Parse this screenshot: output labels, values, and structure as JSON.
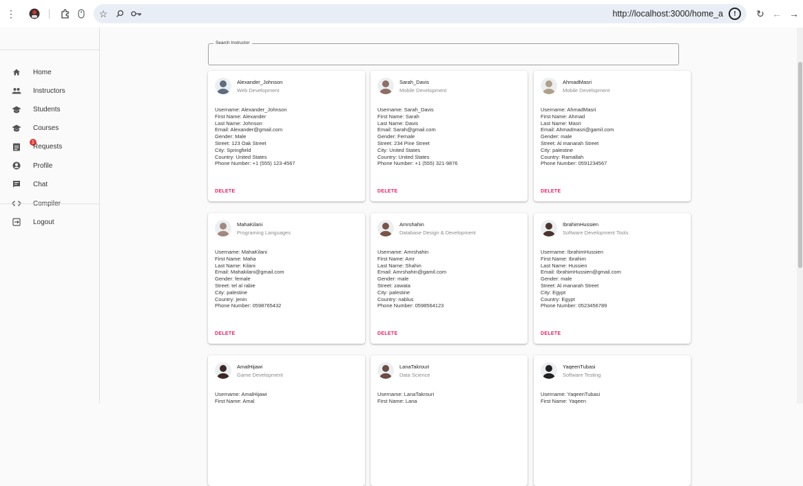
{
  "browser": {
    "url": "http://localhost:3000/home_a"
  },
  "sidebar": {
    "items": [
      {
        "label": "Home",
        "icon": "home-icon"
      },
      {
        "label": "Instructors",
        "icon": "group-icon"
      },
      {
        "label": "Students",
        "icon": "school-icon"
      },
      {
        "label": "Courses",
        "icon": "school-icon"
      },
      {
        "label": "Requests",
        "icon": "assignment-icon",
        "badge": "1"
      },
      {
        "label": "Profile",
        "icon": "account-icon"
      },
      {
        "label": "Chat",
        "icon": "chat-icon"
      },
      {
        "label": "Compiler",
        "icon": "code-icon"
      },
      {
        "label": "Logout",
        "icon": "logout-icon"
      }
    ]
  },
  "search": {
    "label": "Search Instructor",
    "value": ""
  },
  "cards": [
    {
      "name": "Alexander_Johnson",
      "specialty": "Web Development",
      "lines": [
        "Username: Alexander_Johnson",
        "First Name: Alexander",
        "Last Name: Johnson",
        "Email: Alexander@gmail.com",
        "Gender: Male",
        "Street: 123 Oak Street",
        "City: Springfield",
        "Country: United States",
        "Phone Number: +1 (555) 123-4567"
      ],
      "delete_label": "DELETE",
      "avatar_color": "#5d6d7e"
    },
    {
      "name": "Sarah_Davis",
      "specialty": "Mobile Development",
      "lines": [
        "Username: Sarah_Davis",
        "First Name: Sarah",
        "Last Name: Davis",
        "Email: Sarah@gmail.com",
        "Gender: Female",
        "Street: 234 Pine Street",
        "City: United States",
        "Country: United States",
        "Phone Number: +1 (555) 321-9876"
      ],
      "delete_label": "DELETE",
      "avatar_color": "#8d6e63"
    },
    {
      "name": "AhmadMasri",
      "specialty": "Mobile Development",
      "lines": [
        "Username: AhmadMasri",
        "First Name: Ahmad",
        "Last Name: Masri",
        "Email: Ahmadmasri@gamil.com",
        "Gender: male",
        "Street: Al manarah Street",
        "City: palestine",
        "Country: Ramallah",
        "Phone Number: 0591234567"
      ],
      "delete_label": "DELETE",
      "avatar_color": "#b0a089"
    },
    {
      "name": "MahaKilani",
      "specialty": "Programing Languages",
      "lines": [
        "Username: MahaKilani",
        "First Name: Maha",
        "Last Name: Kilani",
        "Email: Mahakilani@gmail.com",
        "Gender: female",
        "Street: tel al rabie",
        "City: palestine",
        "Country: jenin",
        "Phone Number: 0598765432"
      ],
      "delete_label": "DELETE",
      "avatar_color": "#a1887f"
    },
    {
      "name": "Amrshahin",
      "specialty": "Database Design & Development",
      "lines": [
        "Username: Amrshahin",
        "First Name: Amr",
        "Last Name: Shahin",
        "Email: Amrshahin@gamil.com",
        "Gender: male",
        "Street: zawata",
        "City: palestine",
        "Country: nablus",
        "Phone Number: 0598564123"
      ],
      "delete_label": "DELETE",
      "avatar_color": "#795548"
    },
    {
      "name": "IbrahimHussien",
      "specialty": "Software Development Tools",
      "lines": [
        "Username: IbrahimHussien",
        "First Name: Ibrahim",
        "Last Name: Hussien",
        "Email: IbrahimHussien@gmail.com",
        "Gender: male",
        "Street: Al manarah Street",
        "City: Egypt",
        "Country: Egypt",
        "Phone Number: 0523456789"
      ],
      "delete_label": "DELETE",
      "avatar_color": "#4e342e"
    },
    {
      "name": "AmalHijawi",
      "specialty": "Game Development",
      "lines": [
        "Username: AmalHijawi",
        "First Name: Amal"
      ],
      "delete_label": "",
      "avatar_color": "#3e2723"
    },
    {
      "name": "LanaTakrouri",
      "specialty": "Data Science",
      "lines": [
        "Username: LanaTakrouri",
        "First Name: Lana"
      ],
      "delete_label": "",
      "avatar_color": "#6d4c41"
    },
    {
      "name": "YaqeenTubasi",
      "specialty": "Software Testing",
      "lines": [
        "Username: YaqeenTubasi",
        "First Name: Yaqeen"
      ],
      "delete_label": "",
      "avatar_color": "#212121"
    }
  ]
}
